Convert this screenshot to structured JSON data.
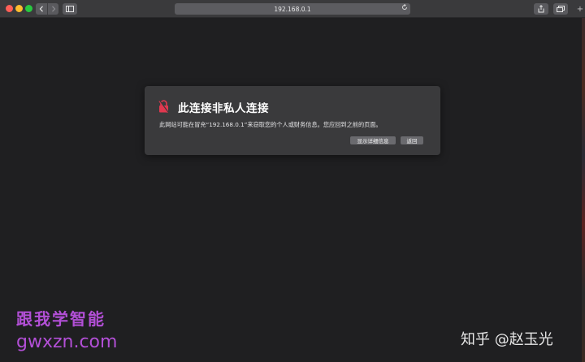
{
  "browser": {
    "address": "192.168.0.1",
    "icons": {
      "back": "chevron-left-icon",
      "forward": "chevron-right-icon",
      "sidebar": "sidebar-icon",
      "reload": "reload-icon",
      "share": "share-icon",
      "tabs": "tabs-icon",
      "new_tab": "plus-icon"
    }
  },
  "dialog": {
    "title": "此连接非私人连接",
    "message": "此网站可能在冒充“192.168.0.1”来窃取您的个人或财务信息。您应回到之前的页面。",
    "details_button": "显示详细信息",
    "back_button": "返回",
    "icon": "broken-lock-icon",
    "icon_color": "#e0384f"
  },
  "watermarks": {
    "brand_cn": "跟我学智能",
    "brand_url": "gwxzn.com",
    "zhihu": "知乎 @赵玉光",
    "brand_color": "#b24fd6"
  }
}
